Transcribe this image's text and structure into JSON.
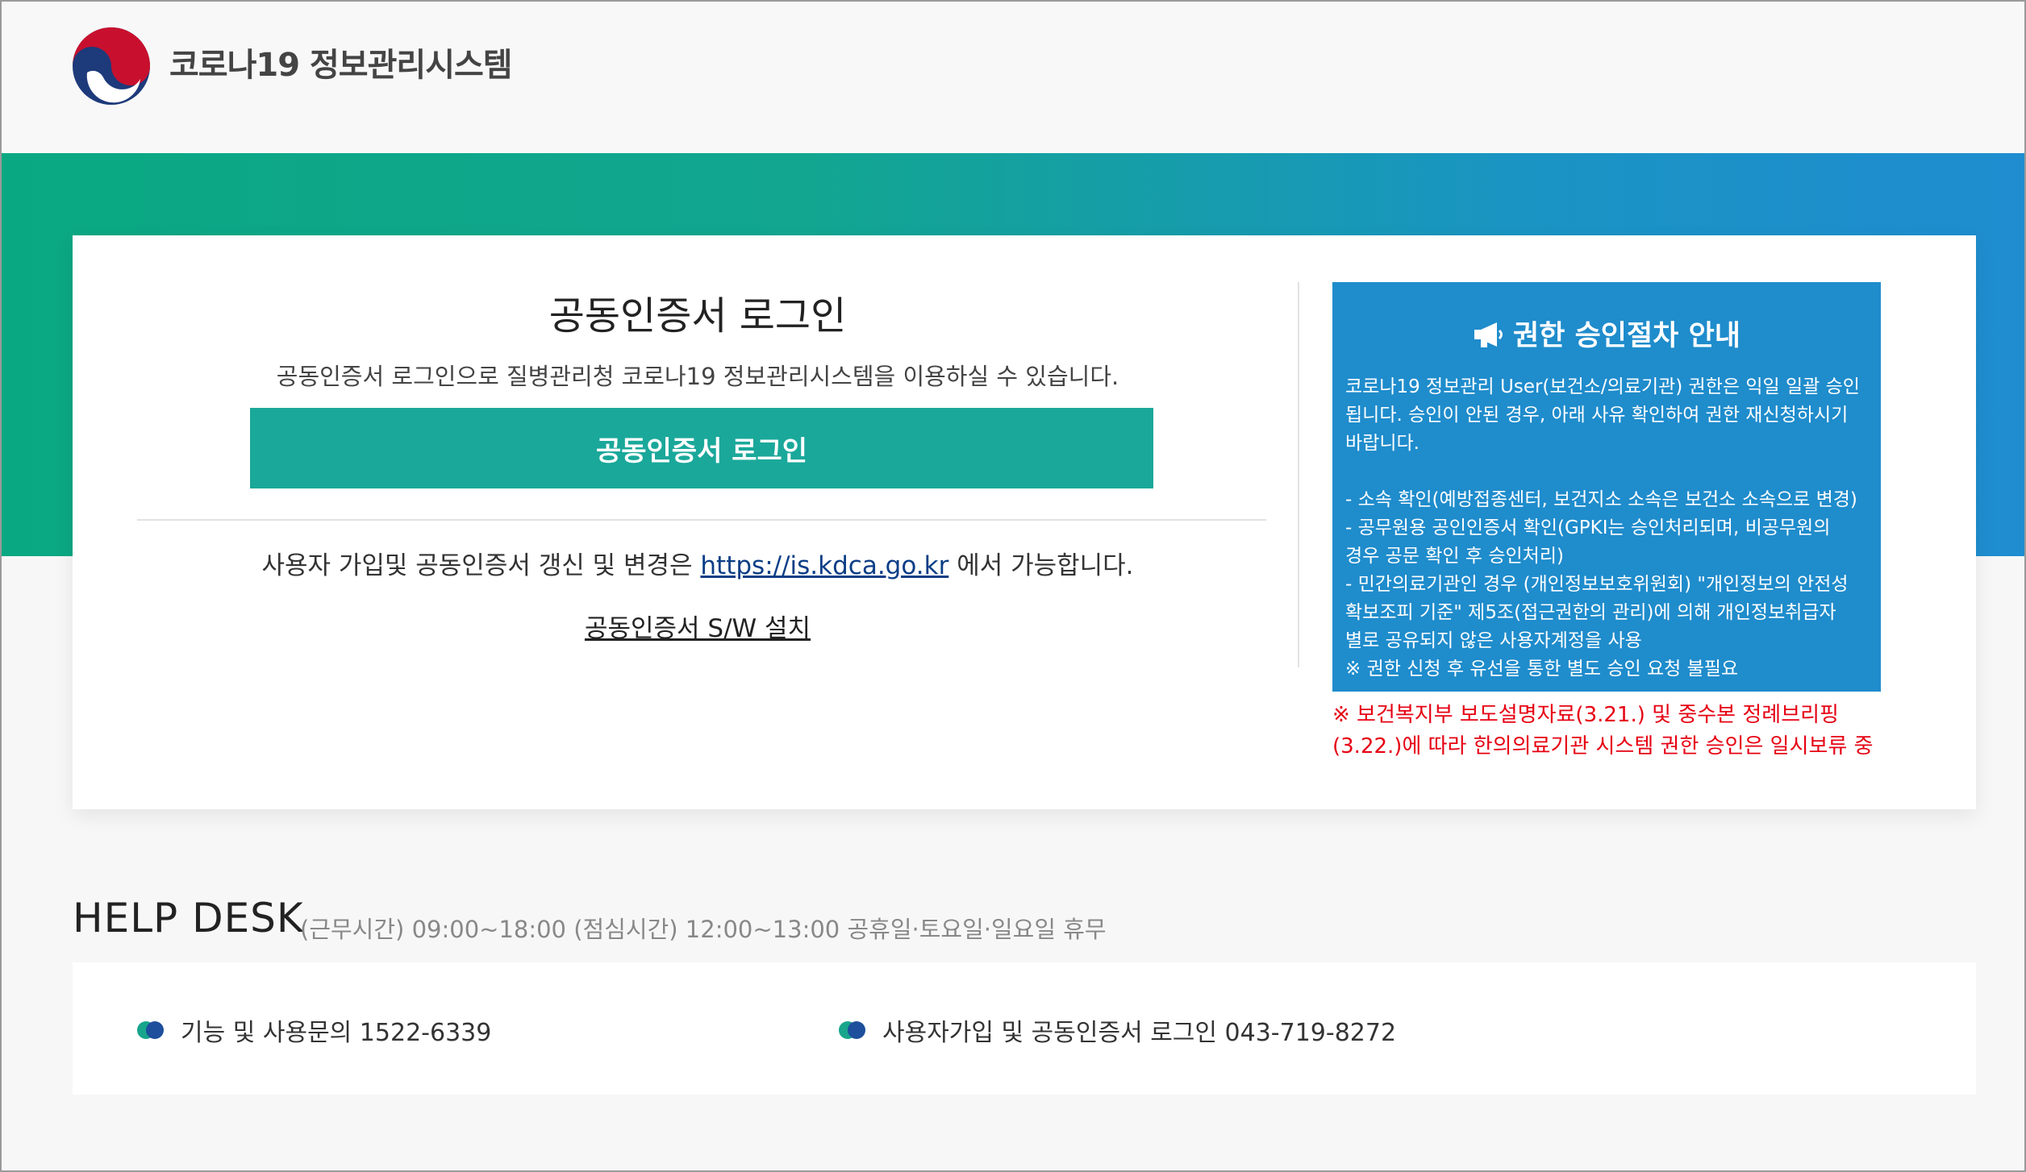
{
  "header": {
    "site_title": "코로나19 정보관리시스템"
  },
  "login": {
    "title": "공동인증서 로그인",
    "description": "공동인증서 로그인으로 질병관리청 코로나19 정보관리시스템을 이용하실 수 있습니다.",
    "button_label": "공동인증서 로그인",
    "signup_prefix": "사용자 가입및 공동인증서 갱신 및 변경은",
    "signup_link": "https://is.kdca.go.kr",
    "signup_suffix": "에서 가능합니다.",
    "sw_install_label": "공동인증서 S/W 설치"
  },
  "notice": {
    "title": "권한 승인절차 안내",
    "body": "코로나19 정보관리 User(보건소/의료기관) 권한은 익일 일괄 승인\n됩니다. 승인이 안된 경우, 아래 사유 확인하여 권한 재신청하시기\n바랍니다.\n\n- 소속 확인(예방접종센터, 보건지소 소속은 보건소 소속으로 변경)\n- 공무원용 공인인증서 확인(GPKI는 승인처리되며, 비공무원의\n   경우 공문 확인 후 승인처리)\n- 민간의료기관인 경우 (개인정보보호위원회) \"개인정보의 안전성\n   확보조피 기준\" 제5조(접근권한의 관리)에 의해 개인정보취급자\n   별로 공유되지 않은 사용자계정을 사용\n※ 권한 신청 후 유선을 통한 별도 승인 요청 불필요",
    "warning": "※ 보건복지부 보도설명자료(3.21.) 및 중수본 정례브리핑\n(3.22.)에 따라 한의의료기관 시스템 권한 승인은 일시보류 중"
  },
  "helpdesk": {
    "title": "HELP DESK",
    "hours": "(근무시간) 09:00~18:00 (점심시간) 12:00~13:00 공휴일·토요일·일요일 휴무",
    "items": [
      "기능 및 사용문의 1522-6339",
      "사용자가입 및 공동인증서 로그인 043-719-8272"
    ]
  },
  "colors": {
    "banner_start": "#0aa882",
    "banner_end": "#1f8dd0",
    "login_button": "#1aa89a",
    "notice_bg": "#1f8ccc",
    "warning_text": "#e60012"
  }
}
